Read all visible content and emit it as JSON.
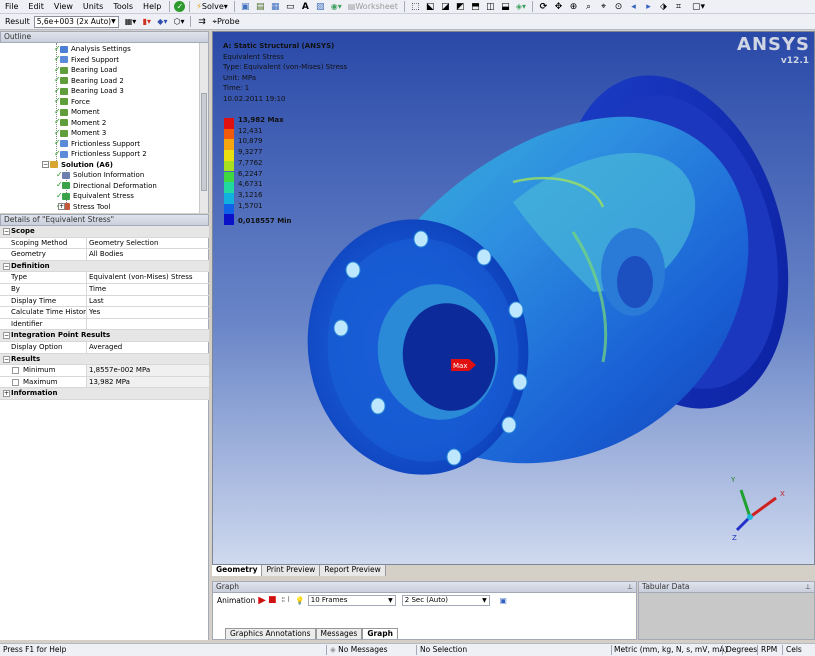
{
  "menubar": {
    "items": [
      "File",
      "Edit",
      "View",
      "Units",
      "Tools",
      "Help"
    ],
    "solve_label": "Solve",
    "worksheet_label": "Worksheet"
  },
  "toolbar2": {
    "result_label": "Result",
    "result_value": "5,6e+003 (2x Auto)",
    "probe_label": "Probe"
  },
  "outline": {
    "title": "Outline",
    "items": [
      {
        "label": "Analysis Settings",
        "color": "#4a7fd3"
      },
      {
        "label": "Fixed Support",
        "color": "#5b8ad8"
      },
      {
        "label": "Bearing Load",
        "color": "#5f9e3a"
      },
      {
        "label": "Bearing Load 2",
        "color": "#5f9e3a"
      },
      {
        "label": "Bearing Load 3",
        "color": "#5f9e3a"
      },
      {
        "label": "Force",
        "color": "#5f9e3a"
      },
      {
        "label": "Moment",
        "color": "#5f9e3a"
      },
      {
        "label": "Moment 2",
        "color": "#5f9e3a"
      },
      {
        "label": "Moment 3",
        "color": "#5f9e3a"
      },
      {
        "label": "Frictionless Support",
        "color": "#5b8ad8"
      },
      {
        "label": "Frictionless Support 2",
        "color": "#5b8ad8"
      },
      {
        "label": "Solution (A6)",
        "color": "#d8a530"
      },
      {
        "label": "Solution Information",
        "color": "#6c7fae"
      },
      {
        "label": "Directional Deformation",
        "color": "#3aa34a"
      },
      {
        "label": "Equivalent Stress",
        "color": "#3aa34a"
      },
      {
        "label": "Stress Tool",
        "color": "#c55a3a"
      }
    ]
  },
  "details": {
    "title": "Details of \"Equivalent Stress\"",
    "rows": [
      {
        "type": "section",
        "label": "Scope",
        "sign": "-"
      },
      {
        "type": "row",
        "label": "Scoping Method",
        "value": "Geometry Selection"
      },
      {
        "type": "row",
        "label": "Geometry",
        "value": "All Bodies"
      },
      {
        "type": "section",
        "label": "Definition",
        "sign": "-"
      },
      {
        "type": "row",
        "label": "Type",
        "value": "Equivalent (von-Mises) Stress"
      },
      {
        "type": "row",
        "label": "By",
        "value": "Time"
      },
      {
        "type": "row",
        "label": "Display Time",
        "value": "Last"
      },
      {
        "type": "row",
        "label": "Calculate Time History",
        "value": "Yes"
      },
      {
        "type": "row",
        "label": "Identifier",
        "value": ""
      },
      {
        "type": "section",
        "label": "Integration Point Results",
        "sign": "-"
      },
      {
        "type": "row",
        "label": "Display Option",
        "value": "Averaged"
      },
      {
        "type": "section",
        "label": "Results",
        "sign": "-"
      },
      {
        "type": "row",
        "label": "Minimum",
        "value": "1,8557e-002 MPa",
        "check": true
      },
      {
        "type": "row",
        "label": "Maximum",
        "value": "13,982 MPa",
        "check": true
      },
      {
        "type": "section",
        "label": "Information",
        "sign": "+"
      }
    ]
  },
  "viewport": {
    "title": "A: Static Structural (ANSYS)",
    "lines": [
      "Equivalent Stress",
      "Type: Equivalent (von-Mises) Stress",
      "Unit: MPa",
      "Time: 1",
      "10.02.2011 19:10"
    ],
    "logo": "ANSYS",
    "version": "v12.1",
    "max_probe_label": "Max",
    "axis_labels": {
      "x": "X",
      "y": "Y",
      "z": "Z"
    },
    "legend": [
      {
        "label": "13,982 Max",
        "color": "#e01010",
        "bold": true
      },
      {
        "label": "12,431",
        "color": "#f05a0a"
      },
      {
        "label": "10,879",
        "color": "#f5a510"
      },
      {
        "label": "9,3277",
        "color": "#e8e010"
      },
      {
        "label": "7,7762",
        "color": "#a8e020"
      },
      {
        "label": "6,2247",
        "color": "#40d840"
      },
      {
        "label": "4,6731",
        "color": "#20d8a0"
      },
      {
        "label": "3,1216",
        "color": "#10b0e0"
      },
      {
        "label": "1,5701",
        "color": "#1060e8"
      },
      {
        "label": "0,018557 Min",
        "color": "#0a10c8",
        "bold": true
      }
    ]
  },
  "bottom_tabs": [
    "Geometry",
    "Print Preview",
    "Report Preview"
  ],
  "graph": {
    "title": "Graph",
    "animation_label": "Animation",
    "frames": "10 Frames",
    "duration": "2 Sec (Auto)",
    "tabs": [
      "Graphics Annotations",
      "Messages",
      "Graph"
    ]
  },
  "tabular": {
    "title": "Tabular Data"
  },
  "statusbar": {
    "help": "Press F1 for Help",
    "messages": "No Messages",
    "selection": "No Selection",
    "units": "Metric (mm, kg, N, s, mV, mA)",
    "angle": "Degrees",
    "rpm": "RPM",
    "temp": "Cels"
  }
}
